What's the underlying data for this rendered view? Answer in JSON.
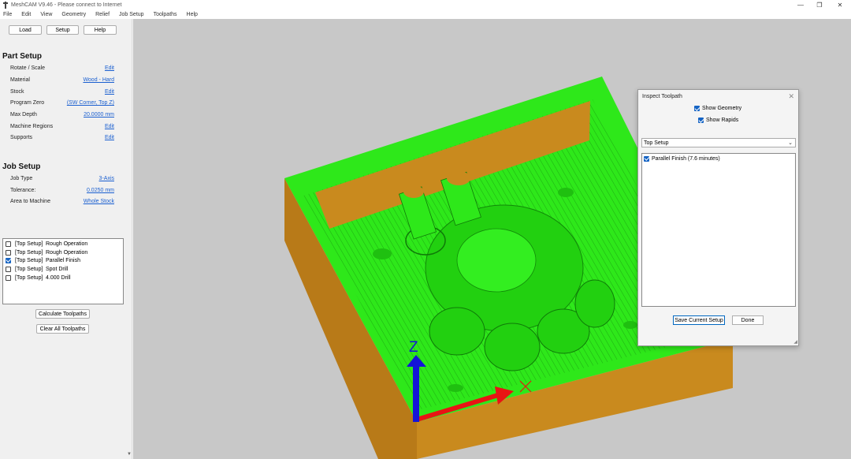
{
  "window": {
    "title": "MeshCAM V9.46 - Please connect to Internet",
    "minimize": "—",
    "maximize": "❐",
    "close": "✕"
  },
  "menu": [
    "File",
    "Edit",
    "View",
    "Geometry",
    "Relief",
    "Job Setup",
    "Toolpaths",
    "Help"
  ],
  "toolbar": {
    "load": "Load",
    "setup": "Setup",
    "help": "Help"
  },
  "part_setup": {
    "title": "Part Setup",
    "rows": [
      {
        "label": "Rotate / Scale",
        "value": "Edit"
      },
      {
        "label": "Material",
        "value": "Wood - Hard"
      },
      {
        "label": "Stock",
        "value": "Edit"
      },
      {
        "label": "Program Zero",
        "value": "(SW Corner, Top Z)"
      },
      {
        "label": "Max Depth",
        "value": "20.0000 mm"
      },
      {
        "label": "Machine Regions",
        "value": "Edit"
      },
      {
        "label": "Supports",
        "value": "Edit"
      }
    ]
  },
  "job_setup": {
    "title": "Job Setup",
    "rows": [
      {
        "label": "Job Type",
        "value": "3-Axis"
      },
      {
        "label": "Tolerance:",
        "value": "0.0250 mm"
      },
      {
        "label": "Area to Machine",
        "value": "Whole Stock"
      }
    ]
  },
  "operations": [
    {
      "setup": "[Top Setup]",
      "name": "Rough Operation",
      "checked": false
    },
    {
      "setup": "[Top Setup]",
      "name": "Rough Operation",
      "checked": false
    },
    {
      "setup": "[Top Setup]",
      "name": "Parallel Finish",
      "checked": true
    },
    {
      "setup": "[Top Setup]",
      "name": "Spot Drill",
      "checked": false
    },
    {
      "setup": "[Top Setup]",
      "name": "4.000 Drill",
      "checked": false
    }
  ],
  "actions": {
    "calculate": "Calculate Toolpaths",
    "clear": "Clear All Toolpaths"
  },
  "viewport": {
    "axis_z": "Z",
    "colors": {
      "background": "#c8c8c8",
      "toolpath": "#2ee81a",
      "stock": "#c98a1e",
      "z_axis": "#1414d8",
      "x_axis": "#e81414"
    }
  },
  "inspect_dialog": {
    "title": "Inspect Toolpath",
    "close": "✕",
    "show_geometry": "Show Geometry",
    "show_rapids": "Show Rapids",
    "setup_select": "Top Setup",
    "toolpath_item": "Parallel Finish (7.6 minutes)",
    "save_button": "Save Current Setup",
    "done_button": "Done"
  }
}
